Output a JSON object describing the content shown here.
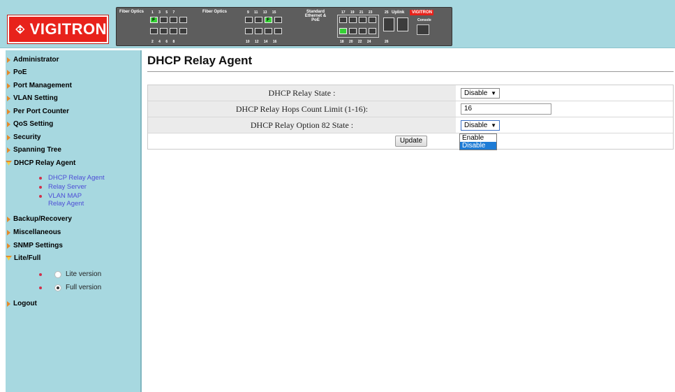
{
  "header": {
    "logo_text": "VIGITRON",
    "panel": {
      "fiber_label_1": "Fiber Optics",
      "fiber_label_2": "Fiber Optics",
      "std_label": "Standard Ethernet & PoE",
      "uplink_label": "Uplink",
      "console_label": "Console",
      "brand": "VIGITRON",
      "top_nums_1": "1 3 5 7",
      "bottom_nums_1": "2 4 6 8",
      "top_nums_2": "9 11 13 15",
      "bottom_nums_2": "10 12 14 16",
      "top_nums_3": "17 19 21 23",
      "bottom_nums_3": "18 20 22 24",
      "top_num_25": "25",
      "bottom_num_26": "26",
      "port_f": "F"
    }
  },
  "sidebar": {
    "items": [
      {
        "label": "Administrator"
      },
      {
        "label": "PoE"
      },
      {
        "label": "Port Management"
      },
      {
        "label": "VLAN Setting"
      },
      {
        "label": "Per Port Counter"
      },
      {
        "label": "QoS Setting"
      },
      {
        "label": "Security"
      },
      {
        "label": "Spanning Tree"
      },
      {
        "label": "DHCP Relay Agent"
      },
      {
        "label": "Backup/Recovery"
      },
      {
        "label": "Miscellaneous"
      },
      {
        "label": "SNMP Settings"
      },
      {
        "label": "Lite/Full"
      },
      {
        "label": "Logout"
      }
    ],
    "dhcp_sub": [
      {
        "label": "DHCP Relay Agent"
      },
      {
        "label": "Relay Server"
      },
      {
        "label": "VLAN MAP Relay Agent"
      }
    ],
    "lite_full": [
      {
        "label": "Lite version",
        "selected": false
      },
      {
        "label": "Full version",
        "selected": true
      }
    ]
  },
  "main": {
    "title": "DHCP Relay Agent",
    "rows": {
      "state_label": "DHCP Relay State :",
      "state_value": "Disable",
      "hops_label": "DHCP Relay Hops Count Limit (1-16):",
      "hops_value": "16",
      "opt82_label": "DHCP Relay Option 82 State :",
      "opt82_value": "Disable"
    },
    "update_label": "Update",
    "dropdown_options": [
      "Enable",
      "Disable"
    ],
    "dropdown_selected": "Disable"
  },
  "colors": {
    "sidebar_bg": "#a7d8e0",
    "arrow": "#e58a2a",
    "link": "#4d4dd6",
    "brand_red": "#e8221b",
    "option_highlight": "#1e7cd6"
  }
}
